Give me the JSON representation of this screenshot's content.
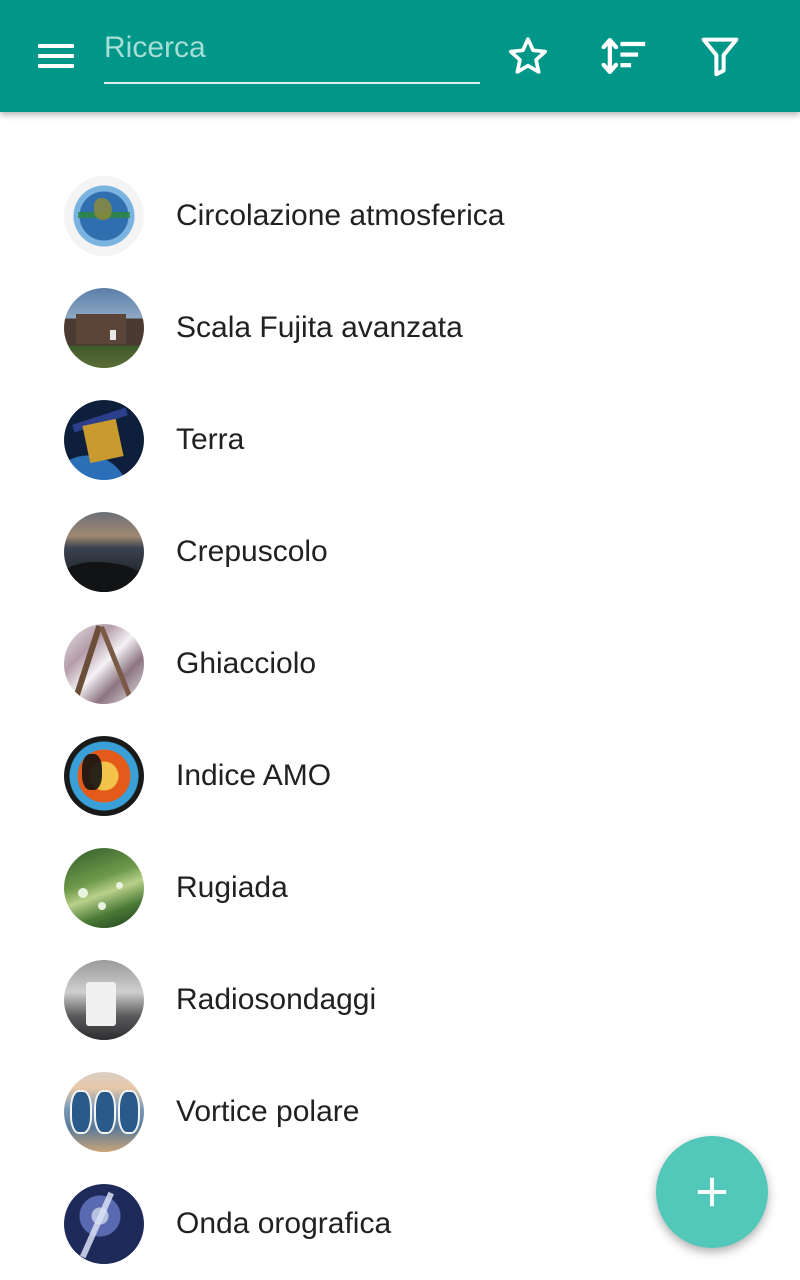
{
  "toolbar": {
    "color": "#009688",
    "menu_icon": "menu-icon",
    "search_placeholder": "Ricerca",
    "search_value": "",
    "actions": [
      {
        "name": "favorites",
        "icon": "star-outline-icon"
      },
      {
        "name": "sort",
        "icon": "sort-icon"
      },
      {
        "name": "filter",
        "icon": "filter-icon"
      }
    ]
  },
  "list": {
    "items": [
      {
        "label": "Circolazione atmosferica",
        "image": "atmospheric-circulation-globe"
      },
      {
        "label": "Scala Fujita avanzata",
        "image": "damaged-house"
      },
      {
        "label": "Terra",
        "image": "satellite-over-earth"
      },
      {
        "label": "Crepuscolo",
        "image": "twilight-coast"
      },
      {
        "label": "Ghiacciolo",
        "image": "icy-branches"
      },
      {
        "label": "Indice AMO",
        "image": "world-temperature-map"
      },
      {
        "label": "Rugiada",
        "image": "dew-on-leaf"
      },
      {
        "label": "Radiosondaggi",
        "image": "radiosonde-device"
      },
      {
        "label": "Vortice polare",
        "image": "polar-vortex-globes"
      },
      {
        "label": "Onda orografica",
        "image": "orographic-wave-sky"
      }
    ]
  },
  "fab": {
    "icon": "plus-icon",
    "color": "#52c8b8"
  }
}
